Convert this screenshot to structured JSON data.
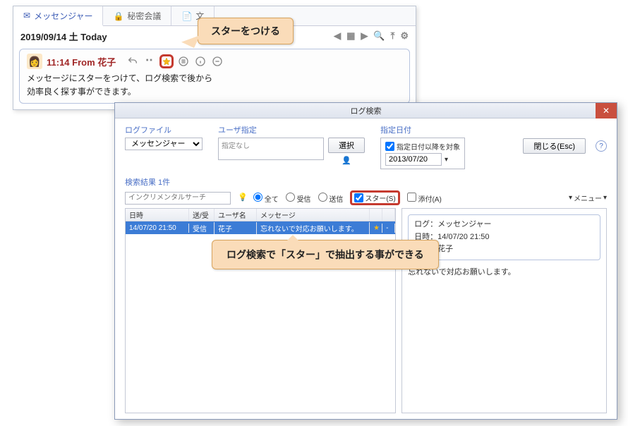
{
  "tabs": {
    "messenger": "メッセンジャー",
    "secret": "秘密会議",
    "doc": "文"
  },
  "dateBar": "2019/09/14 土 Today",
  "dateIcons": {
    "left": "◀",
    "cal": "📅",
    "right": "▶"
  },
  "message": {
    "timeFrom": "11:14 From  花子",
    "line1": "メッセージにスターをつけて、ログ検索で後から",
    "line2": "効率良く探す事ができます。"
  },
  "callout1": "スターをつける",
  "callout2": "ログ検索で「スター」で抽出する事ができる",
  "dialog": {
    "title": "ログ検索",
    "logFile": {
      "label": "ログファイル",
      "value": "メッセンジャー"
    },
    "user": {
      "label": "ユーザ指定",
      "placeholder": "指定なし",
      "selectBtn": "選択"
    },
    "date": {
      "label": "指定日付",
      "after": "指定日付以降を対象",
      "value": "2013/07/20"
    },
    "closeBtn": "閉じる(Esc)",
    "resultsLabel": "検索結果 1件",
    "incSearch": "インクリメンタルサーチ",
    "filters": {
      "all": "全て",
      "recv": "受信",
      "send": "送信",
      "star": "スター(S)",
      "attach": "添付(A)"
    },
    "menu": "メニュー",
    "cols": {
      "dt": "日時",
      "sr": "送/受",
      "user": "ユーザ名",
      "msg": "メッセージ"
    },
    "row": {
      "dt": "14/07/20 21:50",
      "sr": "受信",
      "user": "花子",
      "msg": "忘れないで対応お願いします。"
    },
    "detail": {
      "l1": "ログ：メッセンジャー",
      "l2": "日時：14/07/20 21:50",
      "l3": "受信：花子",
      "body": "忘れないで対応お願いします。"
    }
  }
}
